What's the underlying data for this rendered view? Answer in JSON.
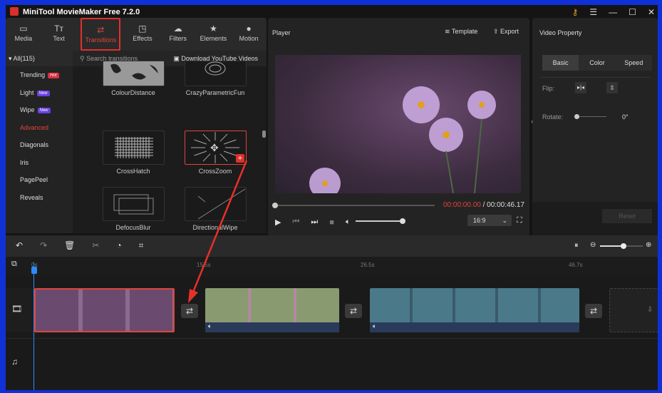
{
  "app": {
    "title": "MiniTool MovieMaker Free 7.2.0"
  },
  "toolbar": {
    "tabs": [
      {
        "label": "Media",
        "icon": "folder-icon"
      },
      {
        "label": "Text",
        "icon": "text-icon"
      },
      {
        "label": "Transitions",
        "icon": "swap-icon",
        "active": true
      },
      {
        "label": "Effects",
        "icon": "effects-icon"
      },
      {
        "label": "Filters",
        "icon": "filters-icon"
      },
      {
        "label": "Elements",
        "icon": "elements-icon"
      },
      {
        "label": "Motion",
        "icon": "motion-icon"
      }
    ]
  },
  "categories": {
    "header": "All(115)",
    "items": [
      {
        "label": "Trending",
        "badge": "Hot"
      },
      {
        "label": "Light",
        "badge": "New"
      },
      {
        "label": "Wipe",
        "badge": "New"
      },
      {
        "label": "Advanced",
        "active": true
      },
      {
        "label": "Diagonals"
      },
      {
        "label": "Iris"
      },
      {
        "label": "PagePeel"
      },
      {
        "label": "Reveals"
      }
    ]
  },
  "search": {
    "placeholder": "Search transitions",
    "download": "Download YouTube Videos"
  },
  "transitions": [
    "ColourDistance",
    "CrazyParametricFun",
    "CrossHatch",
    "CrossZoom",
    "DefocusBlur",
    "DirectionalWipe"
  ],
  "player": {
    "title": "Player",
    "template": "Template",
    "export": "Export",
    "current_time": "00:00:00.00",
    "total_time": "/ 00:00:46.17",
    "aspect": "16:9",
    "volume": 0.9,
    "progress": 0
  },
  "property": {
    "title": "Video Property",
    "tabs": [
      "Basic",
      "Color",
      "Speed"
    ],
    "flip_label": "Flip:",
    "rotate_label": "Rotate:",
    "rotate_value": "0°",
    "reset": "Reset"
  },
  "timeline": {
    "ruler": [
      "0s",
      "15.5s",
      "26.5s",
      "46.7s"
    ],
    "zoom": 0.55
  },
  "colors": {
    "accent": "#e0443c",
    "background": "#1c1c1c"
  }
}
